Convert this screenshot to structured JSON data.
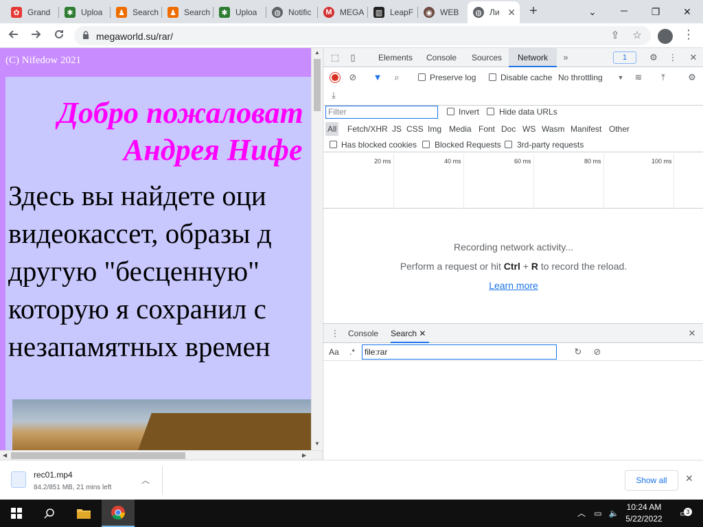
{
  "tabs": [
    {
      "title": "Grand",
      "fav_color": "#e53935",
      "fav_glyph": "✿"
    },
    {
      "title": "Uploa",
      "fav_color": "#2e7d32",
      "fav_glyph": "✱"
    },
    {
      "title": "Search",
      "fav_color": "#ef6c00",
      "fav_glyph": "♟"
    },
    {
      "title": "Search",
      "fav_color": "#ef6c00",
      "fav_glyph": "♟"
    },
    {
      "title": "Uploa",
      "fav_color": "#2e7d32",
      "fav_glyph": "✱"
    },
    {
      "title": "Notific",
      "fav_color": "#5f6368",
      "fav_glyph": "◍"
    },
    {
      "title": "MEGA",
      "fav_color": "#d32f2f",
      "fav_glyph": "M"
    },
    {
      "title": "LeapF",
      "fav_color": "#212121",
      "fav_glyph": "▥"
    },
    {
      "title": "WEB",
      "fav_color": "#6d4c41",
      "fav_glyph": "◉"
    },
    {
      "title": "Ли",
      "fav_color": "#5f6368",
      "fav_glyph": "◍"
    }
  ],
  "active_tab_close": "✕",
  "new_tab": "+",
  "window_controls": {
    "minimize": "⌄",
    "restore": "❐",
    "close": "✕"
  },
  "address": {
    "url": "megaworld.su/rar/"
  },
  "page": {
    "copyright": "(C) Nifedow 2021",
    "welcome_line1": "Добро пожаловат",
    "welcome_line2": "Андрея Нифе",
    "body_lines": [
      "Здесь вы найдете оци",
      "видеокассет, образы д",
      "другую \"бесценную\"",
      "которую я сохранил с",
      "незапамятных времен"
    ]
  },
  "devtools": {
    "tabs": [
      "Elements",
      "Console",
      "Sources",
      "Network"
    ],
    "active_tab": "Network",
    "more": "»",
    "issues_badge": "1",
    "network": {
      "preserve_log": "Preserve log",
      "disable_cache": "Disable cache",
      "throttling": "No throttling",
      "filter_placeholder": "Filter",
      "invert": "Invert",
      "hide_data_urls": "Hide data URLs",
      "types": [
        "All",
        "Fetch/XHR",
        "JS",
        "CSS",
        "Img",
        "Media",
        "Font",
        "Doc",
        "WS",
        "Wasm",
        "Manifest",
        "Other"
      ],
      "has_blocked_cookies": "Has blocked cookies",
      "blocked_requests": "Blocked Requests",
      "third_party": "3rd-party requests",
      "timeline_ticks": [
        "20 ms",
        "40 ms",
        "60 ms",
        "80 ms",
        "100 ms"
      ],
      "recording": "Recording network activity...",
      "hint_prefix": "Perform a request or hit ",
      "hint_key1": "Ctrl",
      "hint_plus": " + ",
      "hint_key2": "R",
      "hint_suffix": " to record the reload.",
      "learn_more": "Learn more"
    },
    "drawer": {
      "tabs": [
        "Console",
        "Search"
      ],
      "active": "Search",
      "match_case": "Aa",
      "regex": ".*",
      "search_value": "file:rar"
    }
  },
  "download": {
    "filename": "rec01.mp4",
    "status": "84.2/851 MB, 21 mins left",
    "show_all": "Show all"
  },
  "taskbar": {
    "time": "10:24 AM",
    "date": "5/22/2022",
    "notifications": "3"
  }
}
